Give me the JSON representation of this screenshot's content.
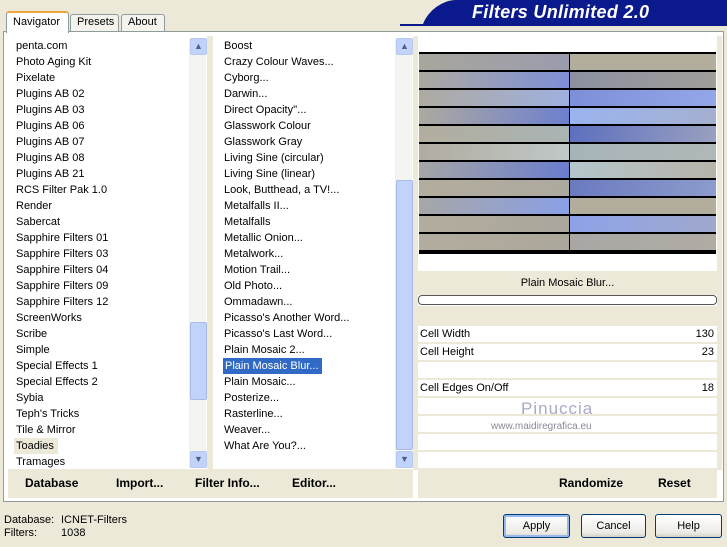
{
  "title": "Filters Unlimited 2.0",
  "tabs": [
    "Navigator",
    "Presets",
    "About"
  ],
  "categories": {
    "items": [
      "penta.com",
      "Photo Aging Kit",
      "Pixelate",
      "Plugins AB 02",
      "Plugins AB 03",
      "Plugins AB 06",
      "Plugins AB 07",
      "Plugins AB 08",
      "Plugins AB 21",
      "RCS Filter Pak 1.0",
      "Render",
      "Sabercat",
      "Sapphire Filters 01",
      "Sapphire Filters 03",
      "Sapphire Filters 04",
      "Sapphire Filters 09",
      "Sapphire Filters 12",
      "ScreenWorks",
      "Scribe",
      "Simple",
      "Special Effects 1",
      "Special Effects 2",
      "Sybia",
      "Teph's Tricks",
      "Tile & Mirror",
      "Toadies",
      "Tramages"
    ],
    "selected": "Toadies"
  },
  "filters": {
    "items": [
      "Boost",
      "Crazy Colour Waves...",
      "Cyborg...",
      "Darwin...",
      "Direct Opacity''...",
      "Glasswork Colour",
      "Glasswork Gray",
      "Living Sine (circular)",
      "Living Sine (linear)",
      "Look, Butthead, a TV!...",
      "Metalfalls II...",
      "Metalfalls",
      "Metallic Onion...",
      "Metalwork...",
      "Motion Trail...",
      "Old Photo...",
      "Ommadawn...",
      "Picasso's Another Word...",
      "Picasso's Last Word...",
      "Plain Mosaic 2...",
      "Plain Mosaic Blur...",
      "Plain Mosaic...",
      "Posterize...",
      "Rasterline...",
      "Weaver...",
      "What Are You?..."
    ],
    "selected": "Plain Mosaic Blur..."
  },
  "filter_name": "Plain Mosaic Blur...",
  "params": [
    {
      "label": "Cell Width",
      "value": "130"
    },
    {
      "label": "Cell Height",
      "value": "23"
    },
    {
      "label": "Cell Edges On/Off",
      "value": "18"
    }
  ],
  "watermark": {
    "name": "Pinuccia",
    "url": "www.maidiregrafica.eu"
  },
  "buttons": {
    "database": "Database",
    "import": "Import...",
    "filter_info": "Filter Info...",
    "editor": "Editor...",
    "randomize": "Randomize",
    "reset": "Reset",
    "apply": "Apply",
    "cancel": "Cancel",
    "help": "Help"
  },
  "status": {
    "database_label": "Database:",
    "database_value": "ICNET-Filters",
    "filters_label": "Filters:",
    "filters_value": "1038"
  }
}
